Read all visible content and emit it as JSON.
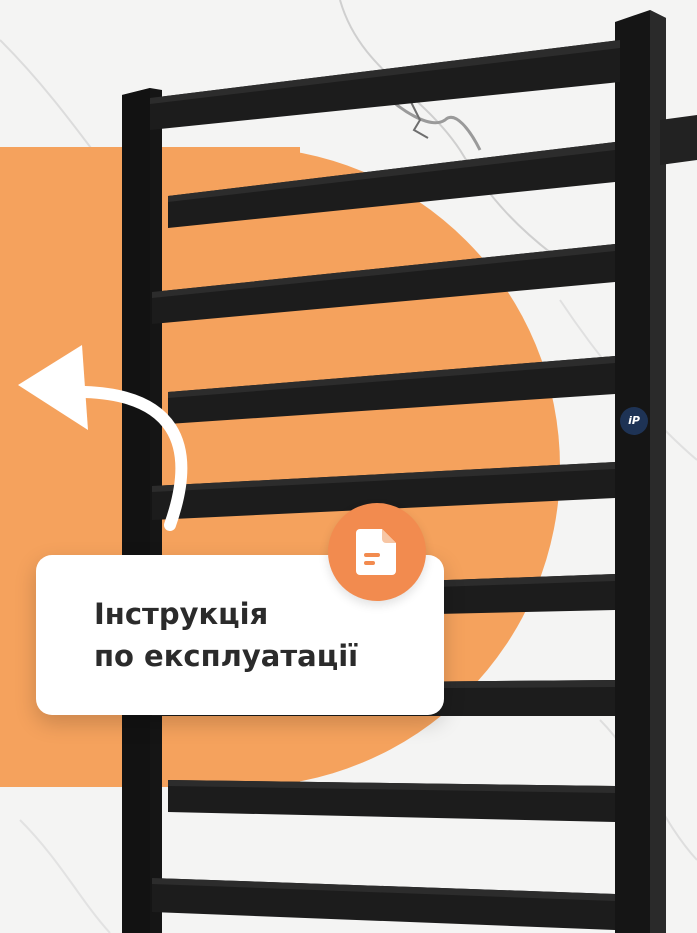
{
  "card": {
    "title_line1": "Інструкція",
    "title_line2": "по експлуатації"
  },
  "badge_icon": "document-icon",
  "back_arrow_icon": "curved-arrow-icon",
  "brand_logo_text": "iP",
  "colors": {
    "accent_orange": "#f5a25d",
    "badge_orange": "#f28b4f",
    "radiator_black": "#1a1a1a",
    "card_white": "#ffffff",
    "text_dark": "#2b2b2b",
    "logo_navy": "#1e3355"
  }
}
